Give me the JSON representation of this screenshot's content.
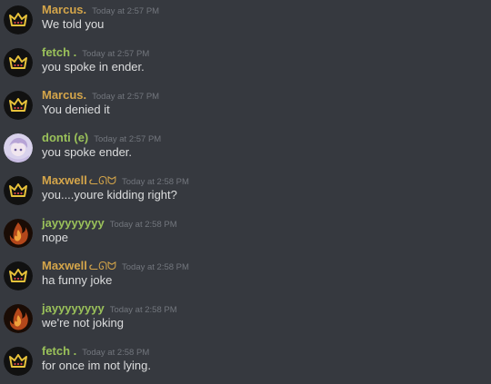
{
  "messages": [
    {
      "author": "Marcus.",
      "author_color": "#d4a54a",
      "timestamp": "Today at 2:57 PM",
      "text": "We told you",
      "avatar": "crown-icon"
    },
    {
      "author": "fetch .",
      "author_color": "#9ac15a",
      "timestamp": "Today at 2:57 PM",
      "text": "you spoke in ender.",
      "avatar": "crown-icon"
    },
    {
      "author": "Marcus.",
      "author_color": "#d4a54a",
      "timestamp": "Today at 2:57 PM",
      "text": "You denied it",
      "avatar": "crown-icon"
    },
    {
      "author": "donti (e)",
      "author_color": "#9ac15a",
      "timestamp": "Today at 2:57 PM",
      "text": "you spoke ender.",
      "avatar": "anime-avatar"
    },
    {
      "author": "Maxwell",
      "author_color": "#d4a54a",
      "emoji": "ᓚᘏᗢ",
      "timestamp": "Today at 2:58 PM",
      "text": "you....youre kidding right?",
      "avatar": "crown-icon"
    },
    {
      "author": "jayyyyyyyy",
      "author_color": "#9ac15a",
      "timestamp": "Today at 2:58 PM",
      "text": "nope",
      "avatar": "fire-avatar"
    },
    {
      "author": "Maxwell",
      "author_color": "#d4a54a",
      "emoji": "ᓚᘏᗢ",
      "timestamp": "Today at 2:58 PM",
      "text": "ha funny joke",
      "avatar": "crown-icon"
    },
    {
      "author": "jayyyyyyyy",
      "author_color": "#9ac15a",
      "timestamp": "Today at 2:58 PM",
      "text": "we're not joking",
      "avatar": "fire-avatar"
    },
    {
      "author": "fetch .",
      "author_color": "#9ac15a",
      "timestamp": "Today at 2:58 PM",
      "text": "for once im not lying.",
      "avatar": "crown-icon"
    }
  ]
}
